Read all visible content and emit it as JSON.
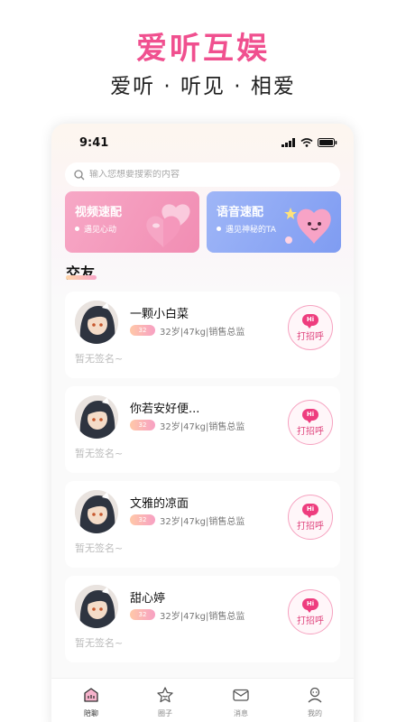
{
  "promo": {
    "title": "爱听互娱",
    "subtitle": "爱听 · 听见 · 相爱"
  },
  "status_bar": {
    "time": "9:41"
  },
  "search": {
    "placeholder": "输入您想要搜索的内容"
  },
  "match_cards": [
    {
      "title": "视频速配",
      "subtitle": "遇见心动",
      "color": "#f18db3"
    },
    {
      "title": "语音速配",
      "subtitle": "遇见神秘的TA",
      "color": "#7f9cf2"
    }
  ],
  "section": {
    "title": "交友"
  },
  "users": [
    {
      "name": "一颗小白菜",
      "badge": "32",
      "info": "32岁|47kg|销售总监",
      "signature": "暂无签名~",
      "greet_hi": "Hi",
      "greet_label": "打招呼"
    },
    {
      "name": "你若安好便...",
      "badge": "32",
      "info": "32岁|47kg|销售总监",
      "signature": "暂无签名~",
      "greet_hi": "Hi",
      "greet_label": "打招呼"
    },
    {
      "name": "文雅的凉面",
      "badge": "32",
      "info": "32岁|47kg|销售总监",
      "signature": "暂无签名~",
      "greet_hi": "Hi",
      "greet_label": "打招呼"
    },
    {
      "name": "甜心婷",
      "badge": "32",
      "info": "32岁|47kg|销售总监",
      "signature": "暂无签名~",
      "greet_hi": "Hi",
      "greet_label": "打招呼"
    }
  ],
  "tabs": [
    {
      "label": "陪聊",
      "icon": "chat-house-icon",
      "active": true
    },
    {
      "label": "圈子",
      "icon": "star-icon",
      "active": false
    },
    {
      "label": "消息",
      "icon": "envelope-icon",
      "active": false
    },
    {
      "label": "我的",
      "icon": "person-icon",
      "active": false
    }
  ],
  "colors": {
    "brand": "#f0508f",
    "greet_accent": "#ee3d7e"
  }
}
